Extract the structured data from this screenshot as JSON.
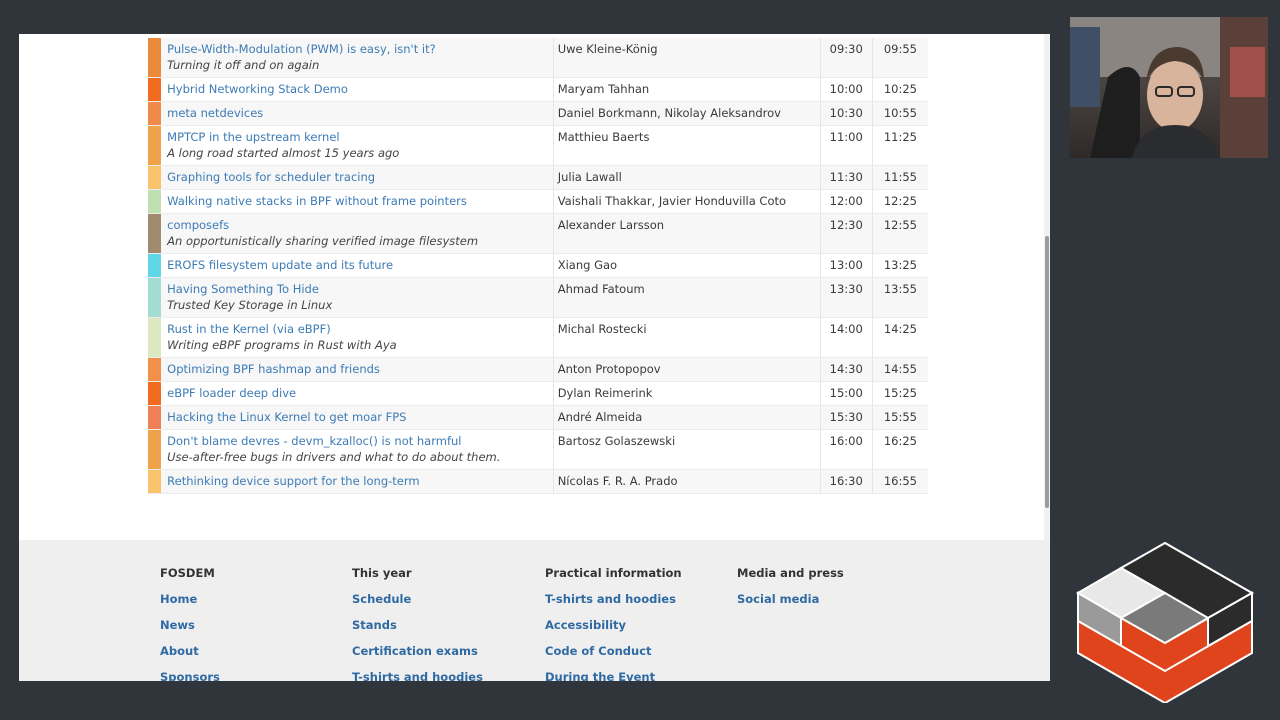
{
  "schedule": {
    "rows": [
      {
        "title": "Pulse-Width-Modulation (PWM) is easy, isn't it?",
        "subtitle": "Turning it off and on again",
        "speakers": "Uwe Kleine-König",
        "start": "09:30",
        "end": "09:55",
        "track_color": "#ea8a3a"
      },
      {
        "title": "Hybrid Networking Stack Demo",
        "subtitle": "",
        "speakers": "Maryam Tahhan",
        "start": "10:00",
        "end": "10:25",
        "track_color": "#f06b1f"
      },
      {
        "title": "meta netdevices",
        "subtitle": "",
        "speakers": "Daniel Borkmann, Nikolay Aleksandrov",
        "start": "10:30",
        "end": "10:55",
        "track_color": "#f08a4a"
      },
      {
        "title": "MPTCP in the upstream kernel",
        "subtitle": "A long road started almost 15 years ago",
        "speakers": "Matthieu Baerts",
        "start": "11:00",
        "end": "11:25",
        "track_color": "#f0a24a"
      },
      {
        "title": "Graphing tools for scheduler tracing",
        "subtitle": "",
        "speakers": "Julia Lawall",
        "start": "11:30",
        "end": "11:55",
        "track_color": "#f8c36b"
      },
      {
        "title": "Walking native stacks in BPF without frame pointers",
        "subtitle": "",
        "speakers": "Vaishali Thakkar, Javier Honduvilla Coto",
        "start": "12:00",
        "end": "12:25",
        "track_color": "#bfe0b0"
      },
      {
        "title": "composefs",
        "subtitle": "An opportunistically sharing verified image filesystem",
        "speakers": "Alexander Larsson",
        "start": "12:30",
        "end": "12:55",
        "track_color": "#a08a70"
      },
      {
        "title": "EROFS filesystem update and its future",
        "subtitle": "",
        "speakers": "Xiang Gao",
        "start": "13:00",
        "end": "13:25",
        "track_color": "#5fd7e6"
      },
      {
        "title": "Having Something To Hide",
        "subtitle": "Trusted Key Storage in Linux",
        "speakers": "Ahmad Fatoum",
        "start": "13:30",
        "end": "13:55",
        "track_color": "#a3dcd0"
      },
      {
        "title": "Rust in the Kernel (via eBPF)",
        "subtitle": "Writing eBPF programs in Rust with Aya",
        "speakers": "Michal Rostecki",
        "start": "14:00",
        "end": "14:25",
        "track_color": "#dbe8c2"
      },
      {
        "title": "Optimizing BPF hashmap and friends",
        "subtitle": "",
        "speakers": "Anton Protopopov",
        "start": "14:30",
        "end": "14:55",
        "track_color": "#f0904a"
      },
      {
        "title": "eBPF loader deep dive",
        "subtitle": "",
        "speakers": "Dylan Reimerink",
        "start": "15:00",
        "end": "15:25",
        "track_color": "#f06b1f"
      },
      {
        "title": "Hacking the Linux Kernel to get moar FPS",
        "subtitle": "",
        "speakers": "André Almeida",
        "start": "15:30",
        "end": "15:55",
        "track_color": "#ee8055"
      },
      {
        "title": "Don't blame devres - devm_kzalloc() is not harmful",
        "subtitle": "Use-after-free bugs in drivers and what to do about them.",
        "speakers": "Bartosz Golaszewski",
        "start": "16:00",
        "end": "16:25",
        "track_color": "#f0a24a"
      },
      {
        "title": "Rethinking device support for the long-term",
        "subtitle": "",
        "speakers": "Nícolas F. R. A. Prado",
        "start": "16:30",
        "end": "16:55",
        "track_color": "#f8c36b"
      }
    ]
  },
  "footer": {
    "columns": [
      {
        "heading": "FOSDEM",
        "links": [
          "Home",
          "News",
          "About",
          "Sponsors"
        ]
      },
      {
        "heading": "This year",
        "links": [
          "Schedule",
          "Stands",
          "Certification exams",
          "T-shirts and hoodies"
        ]
      },
      {
        "heading": "Practical information",
        "links": [
          "T-shirts and hoodies",
          "Accessibility",
          "Code of Conduct",
          "During the Event"
        ]
      },
      {
        "heading": "Media and press",
        "links": [
          "Social media"
        ]
      }
    ]
  },
  "colors": {
    "link": "#3c7bb5",
    "footer_link": "#2f6aa3",
    "background": "#2f353b",
    "logo_red": "#e0441c"
  }
}
